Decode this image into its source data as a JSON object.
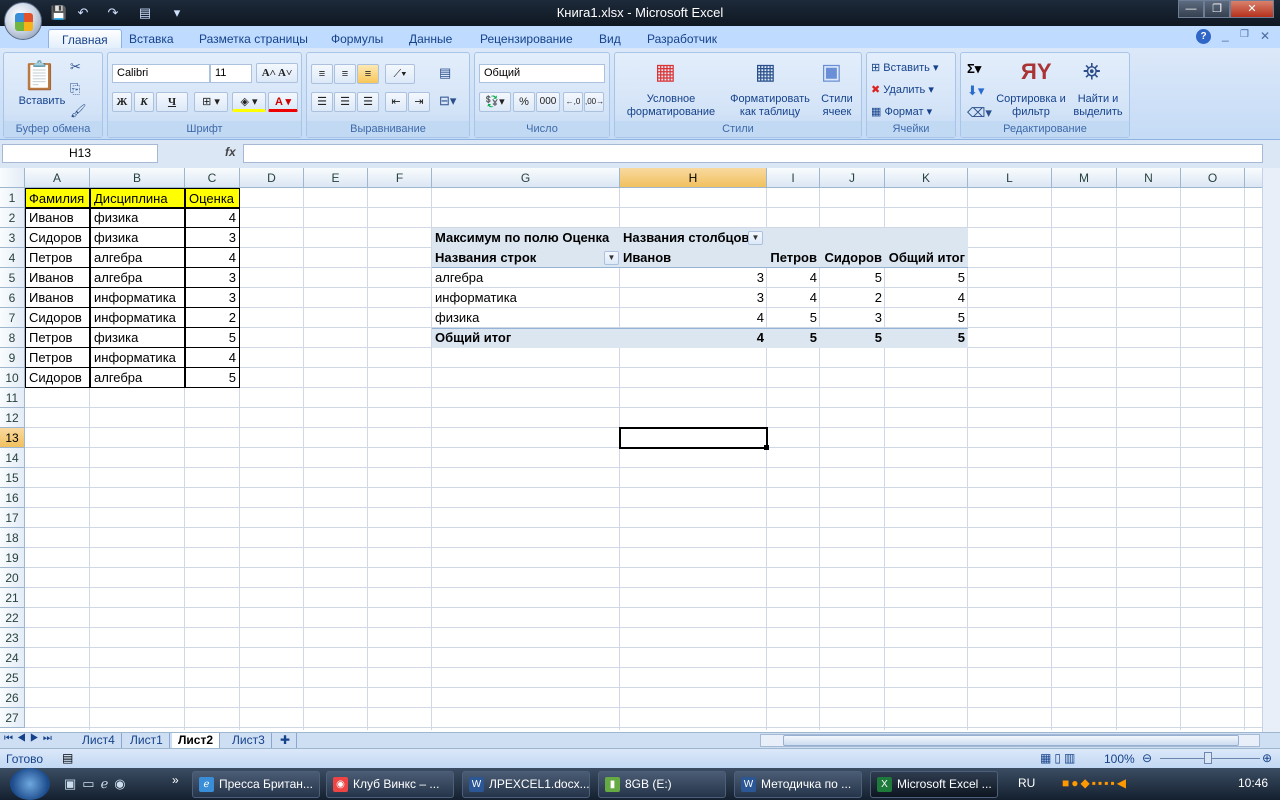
{
  "window": {
    "title": "Книга1.xlsx - Microsoft Excel"
  },
  "ribbon_tabs": [
    "Главная",
    "Вставка",
    "Разметка страницы",
    "Формулы",
    "Данные",
    "Рецензирование",
    "Вид",
    "Разработчик"
  ],
  "ribbon": {
    "clipboard": {
      "label": "Буфер обмена",
      "paste": "Вставить"
    },
    "font": {
      "label": "Шрифт",
      "name": "Calibri",
      "size": "11",
      "bold": "Ж",
      "italic": "К",
      "underline": "Ч"
    },
    "alignment": {
      "label": "Выравнивание"
    },
    "number": {
      "label": "Число",
      "format": "Общий",
      "percent": "%",
      "thousands": "000"
    },
    "styles": {
      "label": "Стили",
      "conditional": "Условное форматирование",
      "format_table": "Форматировать как таблицу",
      "cell_styles": "Стили ячеек"
    },
    "cells": {
      "label": "Ячейки",
      "insert": "Вставить",
      "delete": "Удалить",
      "format": "Формат"
    },
    "editing": {
      "label": "Редактирование",
      "sort": "Сортировка и фильтр",
      "find": "Найти и выделить"
    }
  },
  "formula_bar": {
    "name_box": "H13",
    "fx": "fx",
    "value": ""
  },
  "columns": [
    "A",
    "B",
    "C",
    "D",
    "E",
    "F",
    "G",
    "H",
    "I",
    "J",
    "K",
    "L",
    "M",
    "N",
    "O"
  ],
  "selected_column": "H",
  "selected_row": 13,
  "row_count": 27,
  "source_table": {
    "headers": [
      "Фамилия",
      "Дисциплина",
      "Оценка"
    ],
    "rows": [
      [
        "Иванов",
        "физика",
        "4"
      ],
      [
        "Сидоров",
        "физика",
        "3"
      ],
      [
        "Петров",
        "алгебра",
        "4"
      ],
      [
        "Иванов",
        "алгебра",
        "3"
      ],
      [
        "Иванов",
        "информатика",
        "3"
      ],
      [
        "Сидоров",
        "информатика",
        "2"
      ],
      [
        "Петров",
        "физика",
        "5"
      ],
      [
        "Петров",
        "информатика",
        "4"
      ],
      [
        "Сидоров",
        "алгебра",
        "5"
      ]
    ],
    "header_color": "#ffff00"
  },
  "pivot": {
    "title": "Максимум по полю Оценка",
    "col_label": "Названия столбцов",
    "row_label": "Названия строк",
    "columns": [
      "Иванов",
      "Петров",
      "Сидоров",
      "Общий итог"
    ],
    "rows": [
      [
        "алгебра",
        "3",
        "4",
        "5",
        "5"
      ],
      [
        "информатика",
        "3",
        "4",
        "2",
        "4"
      ],
      [
        "физика",
        "4",
        "5",
        "3",
        "5"
      ]
    ],
    "total": [
      "Общий итог",
      "4",
      "5",
      "5",
      "5"
    ],
    "header_bg": "#dce6f1"
  },
  "sheet_tabs": [
    "Лист4",
    "Лист1",
    "Лист2",
    "Лист3"
  ],
  "active_sheet": "Лист2",
  "status": {
    "ready": "Готово",
    "zoom": "100%"
  },
  "taskbar": {
    "items": [
      "Пресса Британ...",
      "Клуб Винкс – ...",
      "ЛРEXCEL1.docx...",
      "8GB (E:)",
      "Методичка по ...",
      "Microsoft Excel ..."
    ],
    "lang": "RU",
    "clock": "10:46"
  }
}
